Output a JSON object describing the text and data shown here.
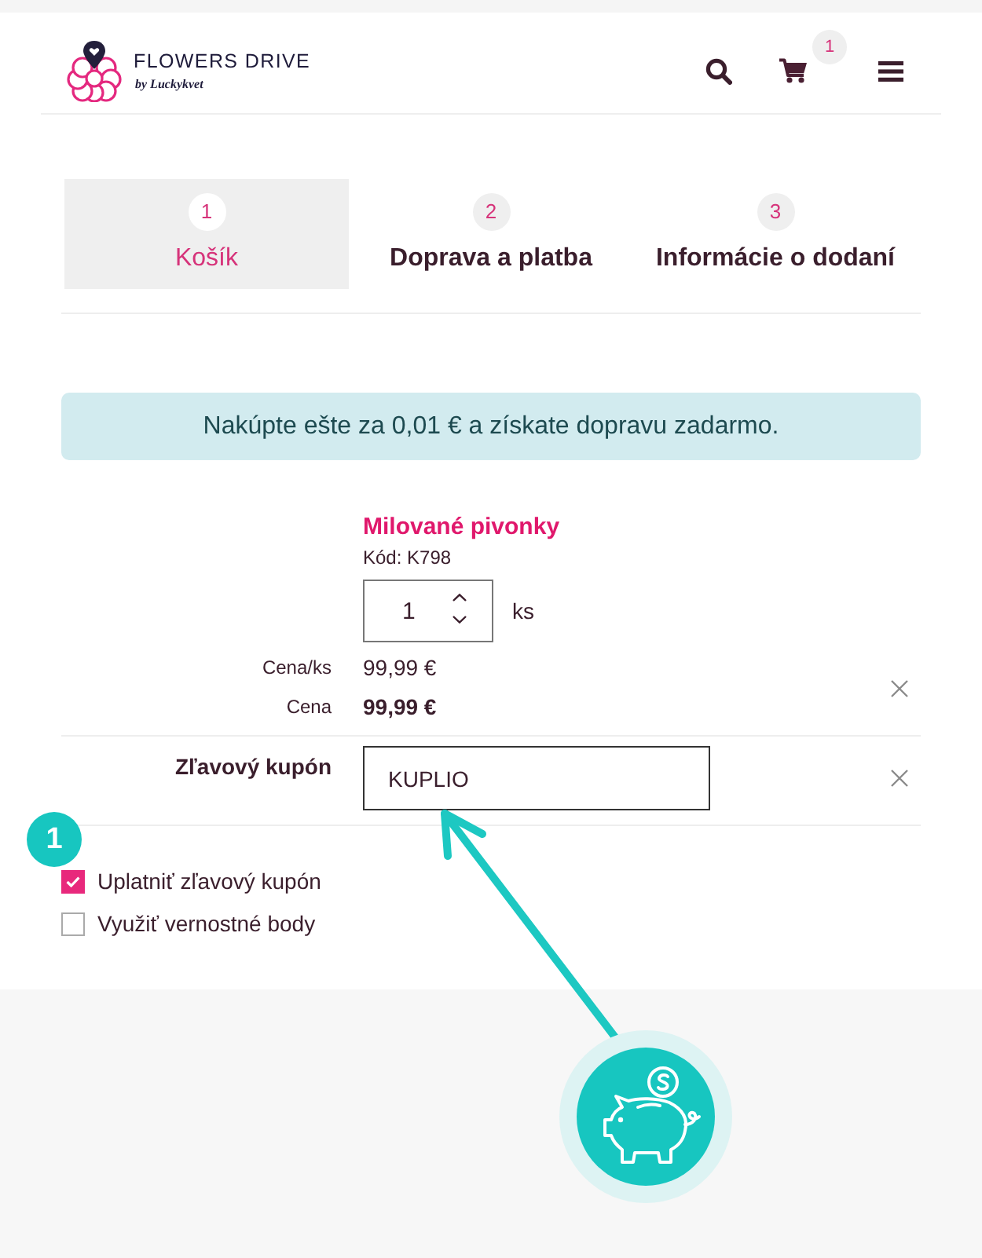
{
  "header": {
    "logo": {
      "name": "FLOWERS DRIVE",
      "tagline": "by Luckykvet"
    },
    "cart_count": "1"
  },
  "steps": [
    {
      "number": "1",
      "label": "Košík",
      "selected": true
    },
    {
      "number": "2",
      "label": "Doprava a platba",
      "selected": false
    },
    {
      "number": "3",
      "label": "Informácie o dodaní",
      "selected": false
    }
  ],
  "notice": "Nakúpte ešte za 0,01 € a získate dopravu zadarmo.",
  "cart_item": {
    "name": "Milované pivonky",
    "code": "Kód: K798",
    "quantity": "1",
    "unit": "ks",
    "unit_price_label": "Cena/ks",
    "unit_price": "99,99 €",
    "price_label": "Cena",
    "price": "99,99 €"
  },
  "coupon": {
    "label": "Zľavový kupón",
    "value": "KUPLIO"
  },
  "options": [
    {
      "label": "Uplatniť zľavový kupón",
      "checked": true
    },
    {
      "label": "Využiť vernostné body",
      "checked": false
    }
  ],
  "annotation": {
    "badge": "1"
  }
}
